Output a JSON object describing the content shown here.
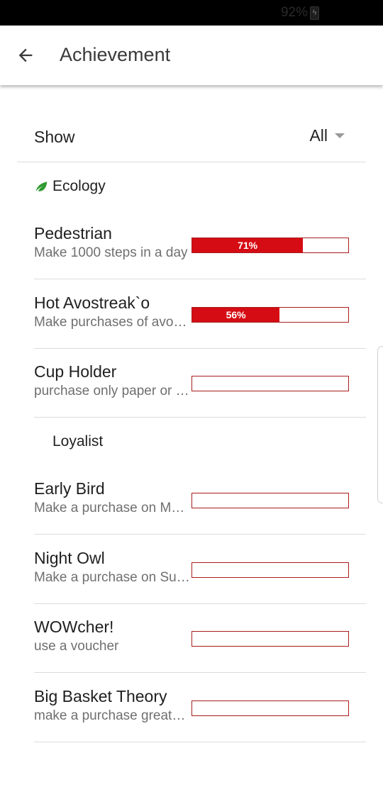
{
  "status_bar": {
    "battery_text": "92%"
  },
  "app_bar": {
    "title": "Achievement"
  },
  "filter": {
    "label": "Show",
    "value": "All"
  },
  "sections": [
    {
      "name": "Ecology",
      "icon": "leaf-icon",
      "icon_color": "#2e9a2e"
    },
    {
      "name": "Loyalist"
    }
  ],
  "items": [
    {
      "name": "Pedestrian",
      "desc": "Make 1000 steps in a day",
      "progress": 0.71,
      "progress_text": "71%"
    },
    {
      "name": "Hot Avostreak`o",
      "desc": "Make purchases of avocado",
      "progress": 0.56,
      "progress_text": "56%"
    },
    {
      "name": "Cup Holder",
      "desc": "purchase only paper or plastic cups",
      "progress": 0,
      "progress_text": ""
    },
    {
      "name": "Early Bird",
      "desc": "Make a purchase on Monday morning",
      "progress": 0,
      "progress_text": ""
    },
    {
      "name": "Night Owl",
      "desc": "Make a purchase on Sunday night",
      "progress": 0,
      "progress_text": ""
    },
    {
      "name": "WOWcher!",
      "desc": "use a voucher",
      "progress": 0,
      "progress_text": ""
    },
    {
      "name": "Big Basket Theory",
      "desc": "make a purchase greater than",
      "progress": 0,
      "progress_text": ""
    }
  ],
  "colors": {
    "bar_fill": "#d50c14",
    "bar_border": "#a81c1c"
  }
}
